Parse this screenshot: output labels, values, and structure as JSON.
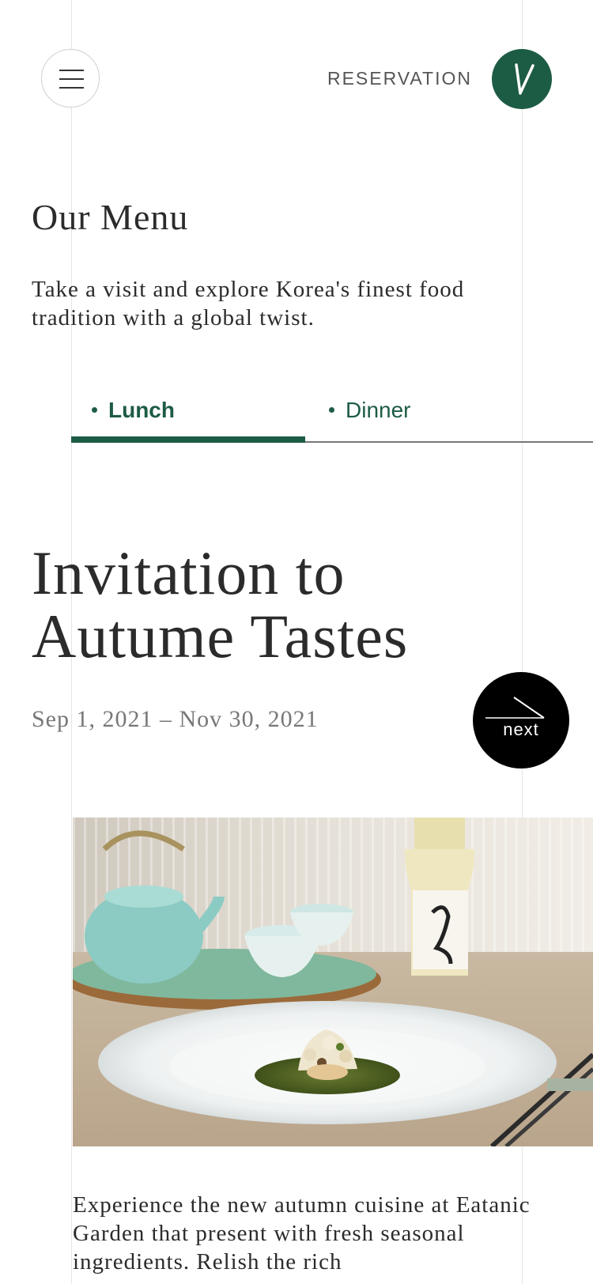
{
  "header": {
    "reservation_label": "RESERVATION",
    "logo_letter": "V",
    "brand_color": "#1d5c44"
  },
  "intro": {
    "title": "Our Menu",
    "description": "Take a visit and explore Korea's finest food tradition with a global twist."
  },
  "tabs": [
    {
      "label": "Lunch",
      "active": true
    },
    {
      "label": "Dinner",
      "active": false
    }
  ],
  "feature": {
    "title_line1": "Invitation to",
    "title_line2": "Autume Tastes",
    "dates": "Sep 1, 2021 – Nov 30, 2021",
    "next_label": "next",
    "image_icon": "dish-photo",
    "description": "Experience the new autumn cuisine at Eatanic Garden that present with fresh seasonal ingredients. Relish the rich"
  }
}
